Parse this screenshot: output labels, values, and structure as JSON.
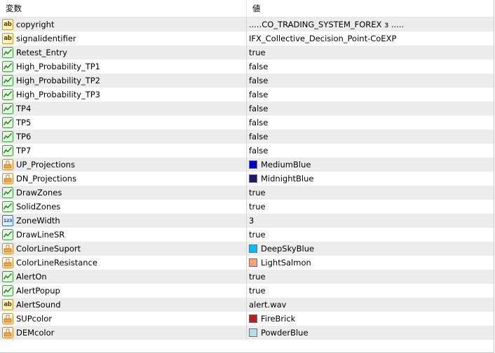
{
  "header": {
    "name_col": "変数",
    "value_col": "値"
  },
  "rows": [
    {
      "name": "copyright",
      "icon": "string-icon",
      "value": ".....CO_TRADING_SYSTEM_FOREX з ....."
    },
    {
      "name": "signalidentifier",
      "icon": "string-icon",
      "value": "    IFX_Collective_Decision_Point-CoEXP"
    },
    {
      "name": "Retest_Entry",
      "icon": "bool-icon",
      "value": "true"
    },
    {
      "name": "High_Probability_TP1",
      "icon": "bool-icon",
      "value": "false"
    },
    {
      "name": "High_Probability_TP2",
      "icon": "bool-icon",
      "value": "false"
    },
    {
      "name": "High_Probability_TP3",
      "icon": "bool-icon",
      "value": "false"
    },
    {
      "name": "TP4",
      "icon": "bool-icon",
      "value": "false"
    },
    {
      "name": "TP5",
      "icon": "bool-icon",
      "value": "false"
    },
    {
      "name": "TP6",
      "icon": "bool-icon",
      "value": "false"
    },
    {
      "name": "TP7",
      "icon": "bool-icon",
      "value": "false"
    },
    {
      "name": "UP_Projections",
      "icon": "color-icon",
      "value": "MediumBlue",
      "swatch": "#0000CD"
    },
    {
      "name": "DN_Projections",
      "icon": "color-icon",
      "value": "MidnightBlue",
      "swatch": "#191970"
    },
    {
      "name": "DrawZones",
      "icon": "bool-icon",
      "value": "true"
    },
    {
      "name": "SolidZones",
      "icon": "bool-icon",
      "value": "true"
    },
    {
      "name": "ZoneWidth",
      "icon": "integer-icon",
      "value": "3"
    },
    {
      "name": "DrawLineSR",
      "icon": "bool-icon",
      "value": "true"
    },
    {
      "name": "ColorLineSuport",
      "icon": "color-icon",
      "value": "DeepSkyBlue",
      "swatch": "#00BFFF"
    },
    {
      "name": "ColorLineResistance",
      "icon": "color-icon",
      "value": "LightSalmon",
      "swatch": "#FFA07A"
    },
    {
      "name": "AlertOn",
      "icon": "bool-icon",
      "value": "true"
    },
    {
      "name": "AlertPopup",
      "icon": "bool-icon",
      "value": "true"
    },
    {
      "name": "AlertSound",
      "icon": "string-icon",
      "value": "alert.wav"
    },
    {
      "name": "SUPcolor",
      "icon": "color-icon",
      "value": "FireBrick",
      "swatch": "#B22222"
    },
    {
      "name": "DEMcolor",
      "icon": "color-icon",
      "value": "PowderBlue",
      "swatch": "#B0E0E6"
    }
  ],
  "icon_glyphs": {
    "string": "ab",
    "integer": "123"
  }
}
